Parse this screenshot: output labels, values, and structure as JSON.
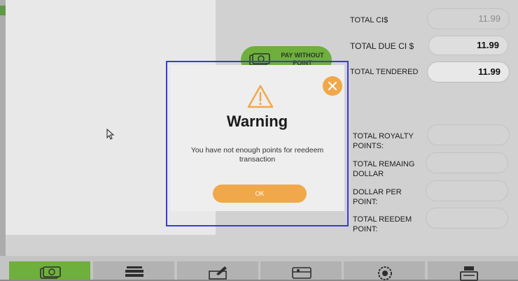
{
  "pay_button": {
    "label": "PAY WITHOUT POINT",
    "icon": "cash-icon"
  },
  "totals": {
    "total_ci": {
      "label": "TOTAL CI$",
      "value": "11.99"
    },
    "total_due": {
      "label": "TOTAL DUE CI $",
      "value": "11.99"
    },
    "total_tendered": {
      "label": "TOTAL TENDERED",
      "value": "11.99"
    }
  },
  "points": {
    "royalty": {
      "label": "TOTAL ROYALTY POINTS:",
      "value": ""
    },
    "remaining": {
      "label": "TOTAL REMAING DOLLAR",
      "value": ""
    },
    "dollar_per_point": {
      "label": "DOLLAR PER POINT:",
      "value": ""
    },
    "redeem": {
      "label": "TOTAL REEDEM POINT:",
      "value": ""
    }
  },
  "dialog": {
    "title": "Warning",
    "message": "You have not enough points for reedeem transaction",
    "ok_label": "OK",
    "icon": "warning-icon",
    "close_icon": "close-icon"
  },
  "bottom_tabs": [
    {
      "icon": "cash-icon"
    },
    {
      "icon": "cards-icon"
    },
    {
      "icon": "check-icon"
    },
    {
      "icon": "gift-card-icon"
    },
    {
      "icon": "loyalty-badge-icon"
    },
    {
      "icon": "register-icon"
    }
  ],
  "colors": {
    "accent_green": "#7ac142",
    "accent_orange": "#f0a84a",
    "focus_border": "#3a3ad8"
  }
}
